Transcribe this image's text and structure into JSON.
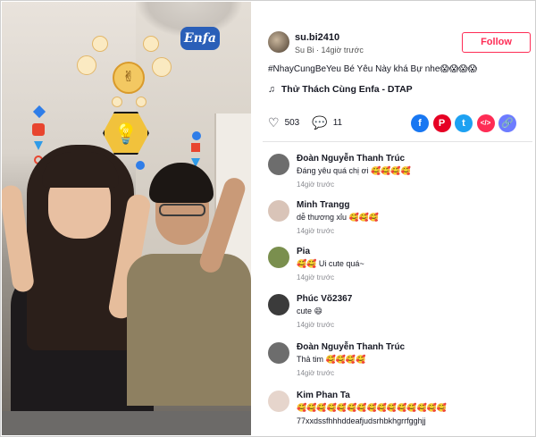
{
  "post": {
    "username": "su.bi2410",
    "subline": "Su Bi · 14giờ trước",
    "follow_label": "Follow",
    "caption": "#NhayCungBeYeu Bé Yêu Này khá Bự nhe😱😱😱😱",
    "music_icon": "♫",
    "music": "Thử Thách Cùng Enfa - DTAP",
    "likes": "503",
    "comments_count": "11",
    "overlay_logo": "Enfa"
  },
  "share_targets": [
    {
      "name": "facebook-icon",
      "glyph": "f",
      "color": "#1877f2"
    },
    {
      "name": "pinterest-icon",
      "glyph": "P",
      "color": "#e60023"
    },
    {
      "name": "twitter-icon",
      "glyph": "t",
      "color": "#1da1f2"
    },
    {
      "name": "embed-icon",
      "glyph": "</>",
      "color": "#fe2c55"
    },
    {
      "name": "link-icon",
      "glyph": "🔗",
      "color": "#6d7cff"
    }
  ],
  "comments": [
    {
      "name": "Đoàn Nguyễn Thanh Trúc",
      "text": "Đáng yêu quá chị ơi 🥰🥰🥰🥰",
      "time": "14giờ trước",
      "avatar_color": "#6d6d6d"
    },
    {
      "name": "Minh Trangg",
      "text": "dễ thương xỉu 🥰🥰🥰",
      "time": "14giờ trước",
      "avatar_color": "#d9c4b8"
    },
    {
      "name": "Pia",
      "text": "🥰🥰 Ui cute quá~",
      "time": "14giờ trước",
      "avatar_color": "#7a8f4e"
    },
    {
      "name": "Phúc Võ2367",
      "text": "cute 😄",
      "time": "14giờ trước",
      "avatar_color": "#3b3b3b"
    },
    {
      "name": "Đoàn Nguyễn Thanh Trúc",
      "text": "Thả tim 🥰🥰🥰🥰",
      "time": "14giờ trước",
      "avatar_color": "#6d6d6d"
    },
    {
      "name": "Kim Phan Ta",
      "text": "🥰🥰🥰🥰🥰🥰🥰🥰🥰🥰🥰🥰🥰🥰🥰",
      "text2": "77xxdssfhhhddeafjudsrhbkhgrrfgghjj",
      "time": "",
      "avatar_color": "#e6d5cc"
    }
  ]
}
